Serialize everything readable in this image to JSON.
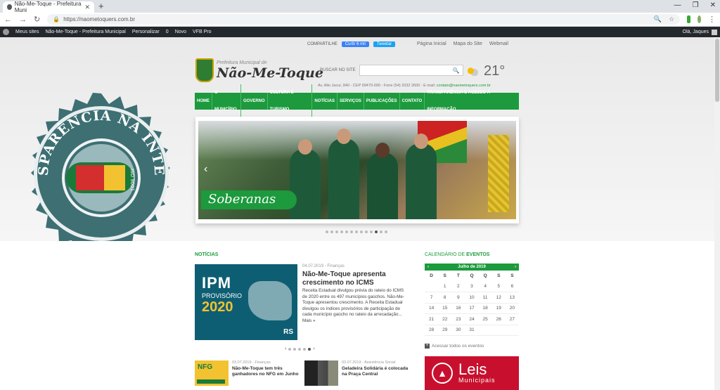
{
  "browser": {
    "tab_title": "Não-Me-Toque - Prefeitura Muni",
    "url": "https://naometoquers.com.br"
  },
  "wpbar": {
    "my_sites": "Meus sites",
    "site_name": "Não-Me-Toque - Prefeitura Municipal",
    "customize": "Personalizar",
    "comments": "0",
    "new": "Novo",
    "vfb": "VFB Pro",
    "greeting": "Olá, Jaques"
  },
  "header": {
    "share_label": "COMPARTILHE",
    "like": "Curtir 6 mil",
    "tweet": "Tweetar",
    "links": [
      "Página Inicial",
      "Mapa do Site",
      "Webmail"
    ],
    "logo_small": "Prefeitura Municipal de",
    "logo_big": "Não-Me-Toque",
    "search_label": "BUSCAR NO SITE",
    "temperature": "21°",
    "address": "Av. Alto Jacuí, 840 - CEP 99470-000 - Fone (54) 3332 2600 - E-mail: ",
    "email": "contato@naometoquers.com.br"
  },
  "menu": [
    "HOME",
    "O MUNICÍPIO",
    "GOVERNO",
    "CULTURA E TURISMO",
    "NOTÍCIAS",
    "SERVIÇOS",
    "PUBLICAÇÕES",
    "CONTATO",
    "TRANSPARÊNCIA E ACESSO À INFORMAÇÃO"
  ],
  "slider": {
    "caption": "Soberanas"
  },
  "seal": {
    "text": "TRANSPARÊNCIA NA INTERNET",
    "iso": "ISO 9001"
  },
  "news": {
    "section_title": "NOTÍCIAS",
    "featured": {
      "img_ipm": "IPM",
      "img_prov": "PROVISÓRIO",
      "img_year": "2020",
      "img_rs": "RS",
      "meta": "04.07.2019 - Finanças",
      "title": "Não-Me-Toque apresenta crescimento no ICMS",
      "body": "Receita Estadual divulgou prévia do rateio do ICMS de 2020 entre os 497 municípios gaúchos. Não-Me-Toque apresentou crescimento. A Receita Estadual divulgou os índices provisórios de participação de cada município gaúcho no rateio da arrecadação... Mais »"
    },
    "mini": [
      {
        "meta": "03.07.2019 - Finanças",
        "title": "Não-Me-Toque tem três ganhadores no NFG em Junho",
        "thumb_text": "NFG"
      },
      {
        "meta": "03.07.2019 - Assistência Social",
        "title": "Geladeira Solidária é colocada na Praça Central"
      }
    ]
  },
  "calendar": {
    "section_label": "CALENDÁRIO DE",
    "section_strong": "EVENTOS",
    "month": "Julho de 2019",
    "weekdays": [
      "D",
      "S",
      "T",
      "Q",
      "Q",
      "S",
      "S"
    ],
    "weeks": [
      [
        "",
        "1",
        "2",
        "3",
        "4",
        "5",
        "6"
      ],
      [
        "7",
        "8",
        "9",
        "10",
        "11",
        "12",
        "13"
      ],
      [
        "14",
        "15",
        "16",
        "17",
        "18",
        "19",
        "20"
      ],
      [
        "21",
        "22",
        "23",
        "24",
        "25",
        "26",
        "27"
      ],
      [
        "28",
        "29",
        "30",
        "31",
        "",
        "",
        ""
      ]
    ],
    "all_events": "Acessar todos os eventos"
  },
  "leis": {
    "title": "Leis",
    "subtitle": "Municipais"
  },
  "colors": {
    "brand_green": "#1c9a3d",
    "leis_red": "#c8102e"
  }
}
